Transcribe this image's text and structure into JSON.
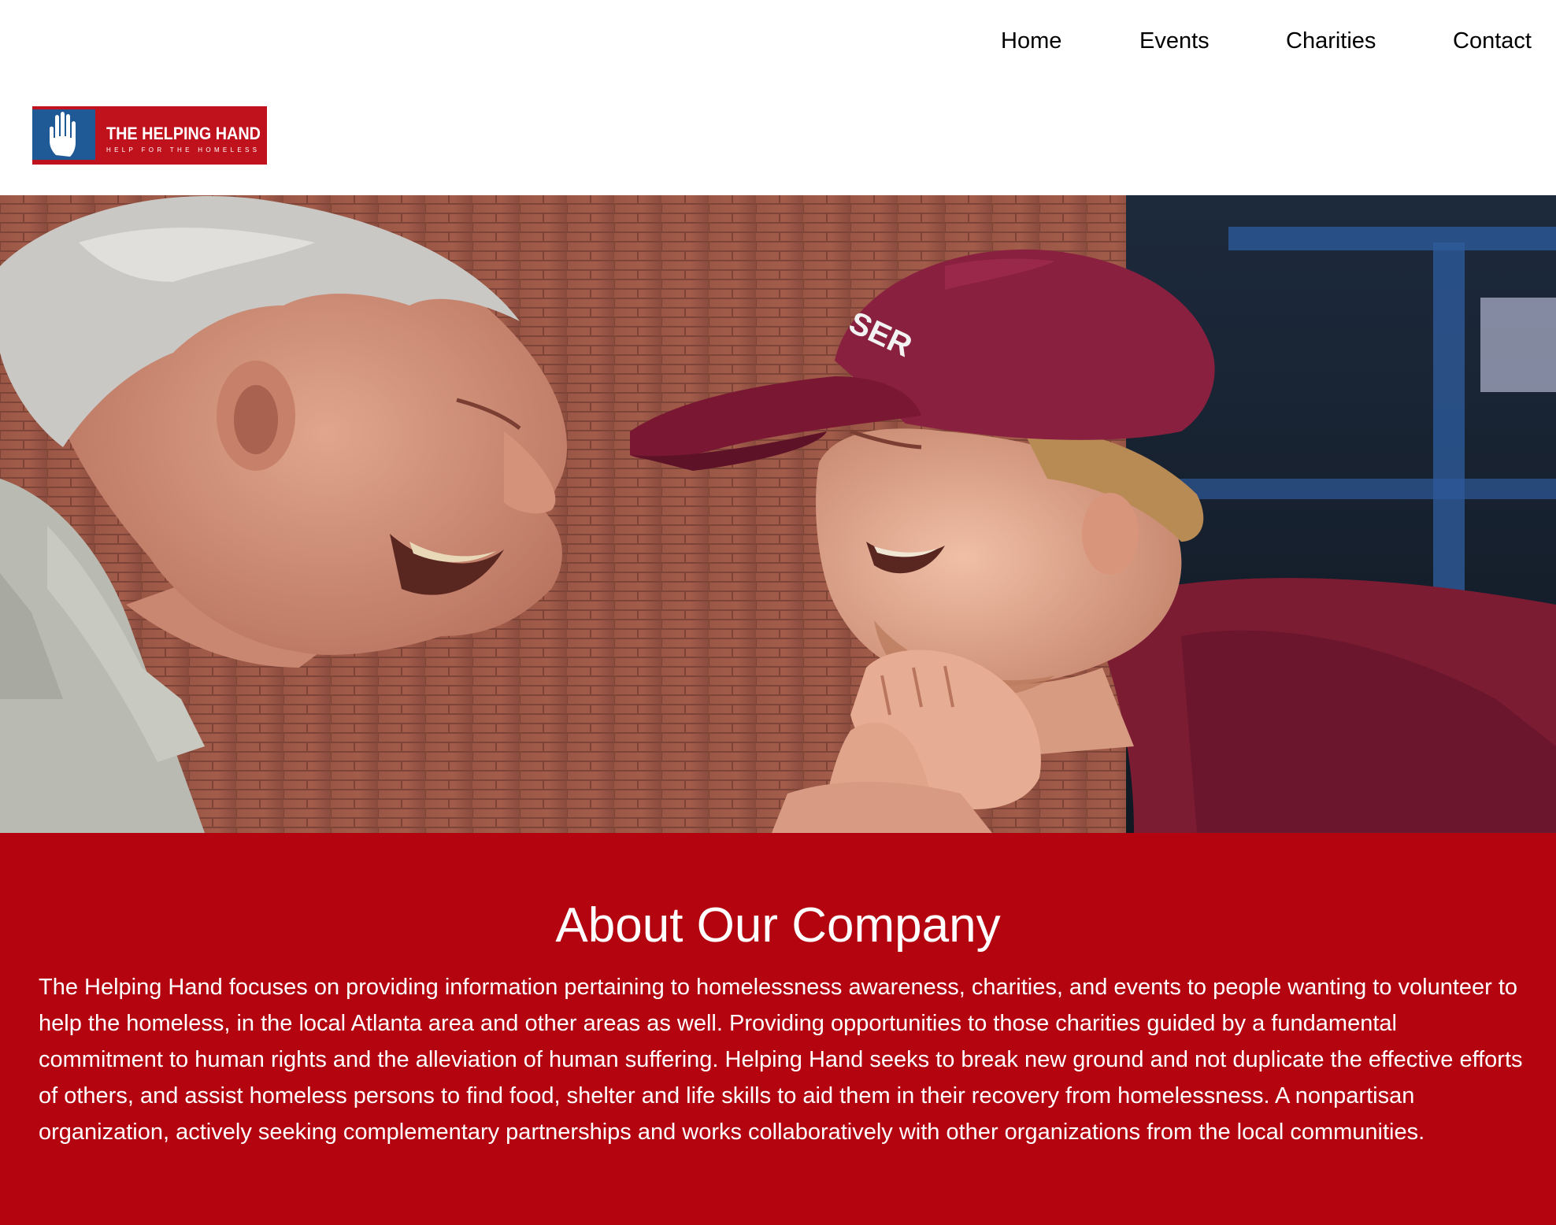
{
  "nav": {
    "home": "Home",
    "events": "Events",
    "charities": "Charities",
    "contact": "Contact"
  },
  "logo": {
    "title": "THE HELPING HAND",
    "tagline": "HELP FOR THE HOMELESS",
    "icon": "raised-hand-icon",
    "colors": {
      "blue": "#1f5a96",
      "red": "#c0121d"
    }
  },
  "hero": {
    "image": "hero-photo",
    "cap_text": "SER"
  },
  "about": {
    "title": "About Our Company",
    "body": "The Helping Hand focuses on providing information pertaining to homelessness awareness, charities, and events to people wanting to volunteer to help the homeless, in the local Atlanta area and other areas as well. Providing opportunities to those charities guided by a fundamental commitment to human rights and the alleviation of human suffering. Helping Hand seeks to break new ground and not duplicate the effective efforts of others, and assist homeless persons to find food, shelter and life skills to aid them in their recovery from homelessness. A nonpartisan organization, actively seeking complementary partnerships and works collaboratively with other organizations from the local communities.",
    "background": "#b3040f"
  }
}
